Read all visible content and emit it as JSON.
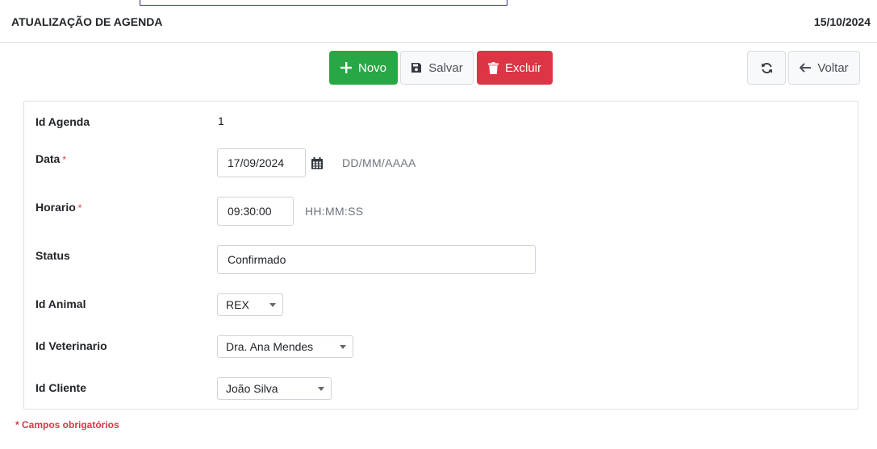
{
  "header": {
    "title": "ATUALIZAÇÃO DE AGENDA",
    "date": "15/10/2024"
  },
  "toolbar": {
    "novo_label": "Novo",
    "salvar_label": "Salvar",
    "excluir_label": "Excluir",
    "voltar_label": "Voltar"
  },
  "form": {
    "id_agenda": {
      "label": "Id Agenda",
      "value": "1"
    },
    "data": {
      "label": "Data",
      "required_mark": "*",
      "value": "17/09/2024",
      "hint": "DD/MM/AAAA"
    },
    "horario": {
      "label": "Horario",
      "required_mark": "*",
      "value": "09:30:00",
      "hint": "HH:MM:SS"
    },
    "status": {
      "label": "Status",
      "value": "Confirmado"
    },
    "id_animal": {
      "label": "Id Animal",
      "value": "REX"
    },
    "id_veterinario": {
      "label": "Id Veterinario",
      "value": "Dra. Ana Mendes"
    },
    "id_cliente": {
      "label": "Id Cliente",
      "value": "João Silva"
    }
  },
  "footer": {
    "required_note": "* Campos obrigatórios"
  },
  "colors": {
    "success": "#28a745",
    "danger": "#dc3545",
    "light": "#f8f9fa"
  }
}
